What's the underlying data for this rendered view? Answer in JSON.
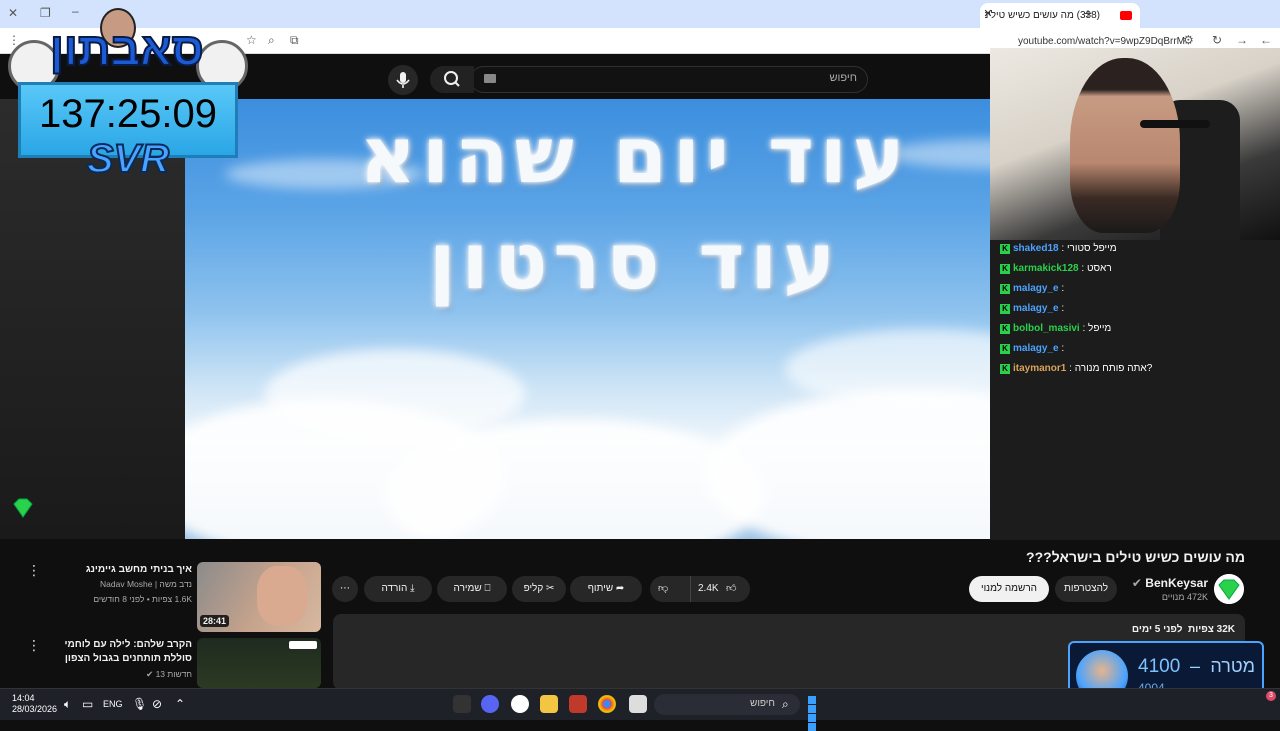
{
  "browser": {
    "tab_title": "(338) מה עושים כשיש טילים בי",
    "tab_close": "✕",
    "new_tab": "+",
    "url": "youtube.com/watch?v=9wpZ9DqBrrM"
  },
  "youtube": {
    "search_placeholder": "חיפוש",
    "video_overlay_line1": "עוד יום שהוא",
    "video_overlay_line2": "עוד סרטון",
    "title": "מה עושים כשיש טילים בישראל???",
    "channel": {
      "name": "BenKeysar",
      "subscribers": "472K מנויים"
    },
    "buttons": {
      "join": "להצטרפות",
      "subscribe": "הרשמה למנוי",
      "like_count": "2.4K",
      "share": "שיתוף",
      "clip": "קליפ",
      "save": "שמירה",
      "download": "הורדה",
      "more": "⋯"
    },
    "description": {
      "views": "32K",
      "views_label": "צפיות",
      "date": "לפני 5 ימים"
    },
    "recommended": [
      {
        "title": "איך בניתי מחשב גיימינג",
        "channel": "נדב משה | Nadav Moshe",
        "meta": "1.6K צפיות • לפני 8 חודשים",
        "duration": "28:41"
      },
      {
        "title": "הקרב שלהם: לילה עם לוחמי סוללת תותחנים בגבול הצפון",
        "channel": "חדשות 13",
        "meta": ""
      }
    ]
  },
  "overlay": {
    "logo": "סאבתון",
    "timer": "137:25:09",
    "tag": "SVR",
    "goal_label": "מטרה",
    "goal_value": "4100",
    "goal_dash": "–",
    "goal_target": "4004"
  },
  "chat": [
    {
      "user": "shaked18",
      "color": "#4aa3ff",
      "msg": ": מייפל סטורי"
    },
    {
      "user": "karmakick128",
      "color": "#2ad14b",
      "msg": ": ראסט"
    },
    {
      "user": "malagy_e",
      "color": "#4aa3ff",
      "msg": ":"
    },
    {
      "user": "malagy_e",
      "color": "#4aa3ff",
      "msg": ":"
    },
    {
      "user": "bolbol_masivi",
      "color": "#2ad14b",
      "msg": ": מייפל"
    },
    {
      "user": "malagy_e",
      "color": "#4aa3ff",
      "msg": ":"
    },
    {
      "user": "itaymanor1",
      "color": "#d7a35a",
      "msg": ": אתה פותח מנורה?"
    }
  ],
  "taskbar": {
    "time": "14:04",
    "date": "28/03/2026",
    "lang": "ENG",
    "search": "חיפוש"
  }
}
